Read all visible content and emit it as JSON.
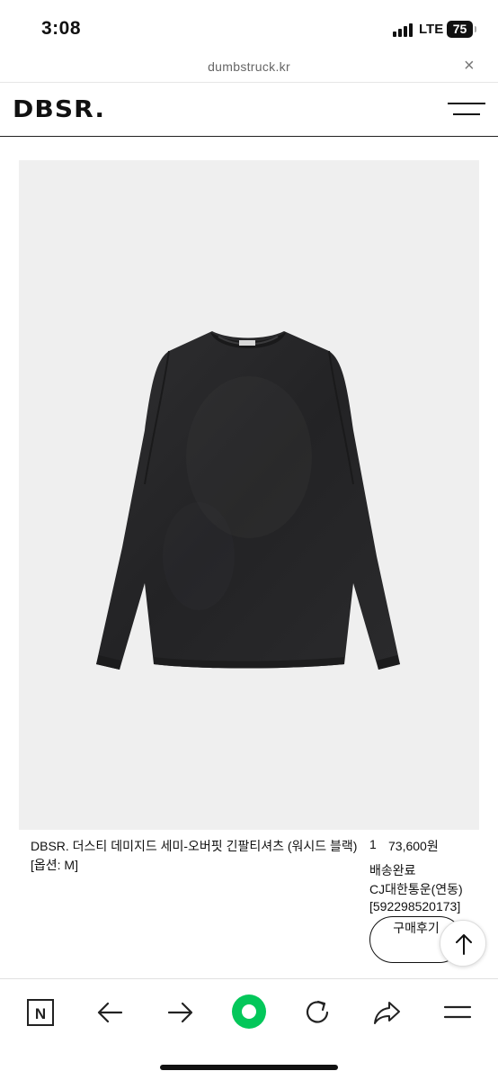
{
  "status_bar": {
    "time": "3:08",
    "network": "LTE",
    "battery": "75"
  },
  "browser": {
    "url": "dumbstruck.kr",
    "close_icon": "×"
  },
  "site": {
    "logo": "DBSR."
  },
  "product": {
    "image_icon": "black-long-sleeve-tshirt",
    "name": "DBSR. 더스티 데미지드 세미-오버핏 긴팔티셔츠 (워시드 블랙)",
    "option": "[옵션: M]",
    "quantity": "1",
    "price": "73,600원"
  },
  "shipping": {
    "status": "배송완료",
    "courier": "CJ대한통운(연동)",
    "tracking": "[592298520173]"
  },
  "actions": {
    "review_label": "구매후기"
  },
  "toolbar": {
    "naver_label": "N",
    "accent_color": "#03c75a"
  }
}
